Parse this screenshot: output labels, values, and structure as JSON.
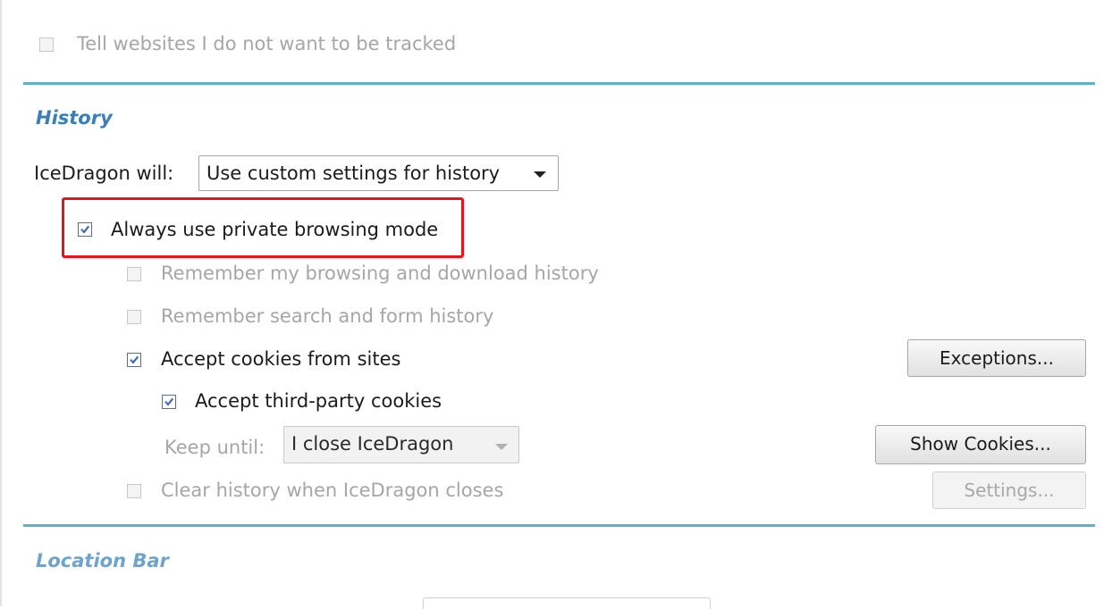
{
  "tracking": {
    "dnt_label": "Tell websites I do not want to be tracked"
  },
  "history": {
    "heading": "History",
    "mode_label": "IceDragon will:",
    "mode_value": "Use custom settings for history",
    "private_label": "Always use private browsing mode",
    "remember_browsing_label": "Remember my browsing and download history",
    "remember_search_label": "Remember search and form history",
    "accept_cookies_label": "Accept cookies from sites",
    "exceptions_label": "Exceptions...",
    "third_party_label": "Accept third-party cookies",
    "keep_until_label": "Keep until:",
    "keep_until_value": "I close IceDragon",
    "show_cookies_label": "Show Cookies...",
    "clear_history_label": "Clear history when IceDragon closes",
    "settings_label": "Settings..."
  },
  "location_bar": {
    "heading": "Location Bar"
  },
  "colors": {
    "separator": "#5fb0cc",
    "heading": "#3a7fb8",
    "highlight": "#e8131b",
    "disabled_text": "#a6a6a6"
  }
}
